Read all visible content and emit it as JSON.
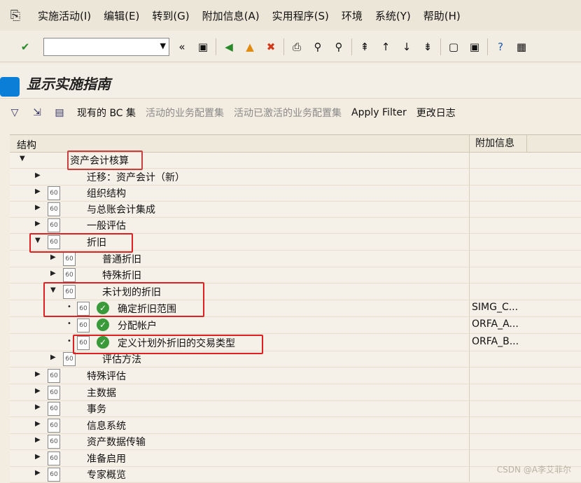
{
  "menu": {
    "items": [
      "实施活动(I)",
      "编辑(E)",
      "转到(G)",
      "附加信息(A)",
      "实用程序(S)",
      "环境",
      "系统(Y)",
      "帮助(H)"
    ]
  },
  "toolbar": {
    "command_value": ""
  },
  "title": "显示实施指南",
  "app_toolbar": {
    "current_bc": "现有的 BC 集",
    "activate_bc": "活动的业务配置集",
    "activated_bc": "活动已激活的业务配置集",
    "apply_filter": "Apply Filter",
    "change_log": "更改日志"
  },
  "tree": {
    "col_structure": "结构",
    "col_additional": "附加信息",
    "rows": [
      {
        "label": "资产会计核算",
        "add": ""
      },
      {
        "label": "迁移：资产会计（新）",
        "add": ""
      },
      {
        "label": "组织结构",
        "add": ""
      },
      {
        "label": "与总账会计集成",
        "add": ""
      },
      {
        "label": "一般评估",
        "add": ""
      },
      {
        "label": "折旧",
        "add": ""
      },
      {
        "label": "普通折旧",
        "add": ""
      },
      {
        "label": "特殊折旧",
        "add": ""
      },
      {
        "label": "未计划的折旧",
        "add": ""
      },
      {
        "label": "确定折旧范围",
        "add": "SIMG_C..."
      },
      {
        "label": "分配帐户",
        "add": "ORFA_A..."
      },
      {
        "label": "定义计划外折旧的交易类型",
        "add": "ORFA_B..."
      },
      {
        "label": "评估方法",
        "add": ""
      },
      {
        "label": "特殊评估",
        "add": ""
      },
      {
        "label": "主数据",
        "add": ""
      },
      {
        "label": "事务",
        "add": ""
      },
      {
        "label": "信息系统",
        "add": ""
      },
      {
        "label": "资产数据传输",
        "add": ""
      },
      {
        "label": "准备启用",
        "add": ""
      },
      {
        "label": "专家概览",
        "add": ""
      }
    ]
  },
  "watermark": "CSDN @A李艾菲尔"
}
